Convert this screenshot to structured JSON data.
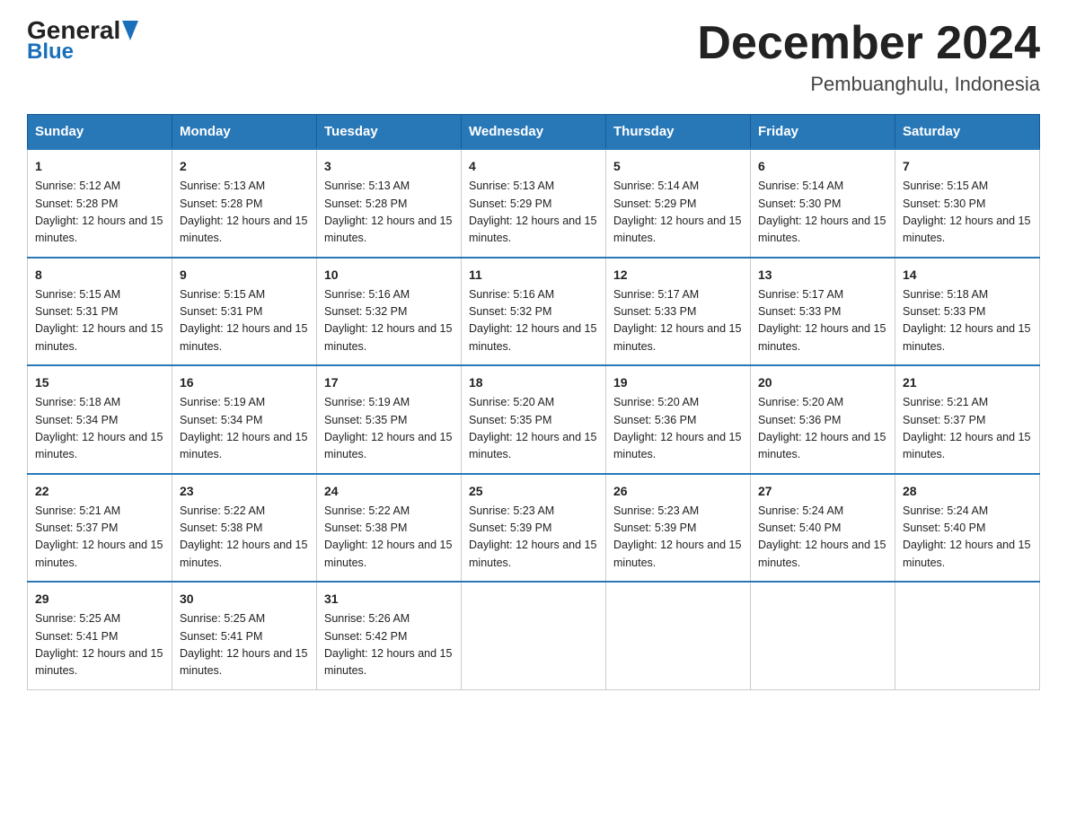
{
  "header": {
    "logo_general": "General",
    "logo_blue": "Blue",
    "title": "December 2024",
    "subtitle": "Pembuanghulu, Indonesia"
  },
  "columns": [
    "Sunday",
    "Monday",
    "Tuesday",
    "Wednesday",
    "Thursday",
    "Friday",
    "Saturday"
  ],
  "weeks": [
    [
      {
        "day": "1",
        "sunrise": "5:12 AM",
        "sunset": "5:28 PM",
        "daylight": "12 hours and 15 minutes."
      },
      {
        "day": "2",
        "sunrise": "5:13 AM",
        "sunset": "5:28 PM",
        "daylight": "12 hours and 15 minutes."
      },
      {
        "day": "3",
        "sunrise": "5:13 AM",
        "sunset": "5:28 PM",
        "daylight": "12 hours and 15 minutes."
      },
      {
        "day": "4",
        "sunrise": "5:13 AM",
        "sunset": "5:29 PM",
        "daylight": "12 hours and 15 minutes."
      },
      {
        "day": "5",
        "sunrise": "5:14 AM",
        "sunset": "5:29 PM",
        "daylight": "12 hours and 15 minutes."
      },
      {
        "day": "6",
        "sunrise": "5:14 AM",
        "sunset": "5:30 PM",
        "daylight": "12 hours and 15 minutes."
      },
      {
        "day": "7",
        "sunrise": "5:15 AM",
        "sunset": "5:30 PM",
        "daylight": "12 hours and 15 minutes."
      }
    ],
    [
      {
        "day": "8",
        "sunrise": "5:15 AM",
        "sunset": "5:31 PM",
        "daylight": "12 hours and 15 minutes."
      },
      {
        "day": "9",
        "sunrise": "5:15 AM",
        "sunset": "5:31 PM",
        "daylight": "12 hours and 15 minutes."
      },
      {
        "day": "10",
        "sunrise": "5:16 AM",
        "sunset": "5:32 PM",
        "daylight": "12 hours and 15 minutes."
      },
      {
        "day": "11",
        "sunrise": "5:16 AM",
        "sunset": "5:32 PM",
        "daylight": "12 hours and 15 minutes."
      },
      {
        "day": "12",
        "sunrise": "5:17 AM",
        "sunset": "5:33 PM",
        "daylight": "12 hours and 15 minutes."
      },
      {
        "day": "13",
        "sunrise": "5:17 AM",
        "sunset": "5:33 PM",
        "daylight": "12 hours and 15 minutes."
      },
      {
        "day": "14",
        "sunrise": "5:18 AM",
        "sunset": "5:33 PM",
        "daylight": "12 hours and 15 minutes."
      }
    ],
    [
      {
        "day": "15",
        "sunrise": "5:18 AM",
        "sunset": "5:34 PM",
        "daylight": "12 hours and 15 minutes."
      },
      {
        "day": "16",
        "sunrise": "5:19 AM",
        "sunset": "5:34 PM",
        "daylight": "12 hours and 15 minutes."
      },
      {
        "day": "17",
        "sunrise": "5:19 AM",
        "sunset": "5:35 PM",
        "daylight": "12 hours and 15 minutes."
      },
      {
        "day": "18",
        "sunrise": "5:20 AM",
        "sunset": "5:35 PM",
        "daylight": "12 hours and 15 minutes."
      },
      {
        "day": "19",
        "sunrise": "5:20 AM",
        "sunset": "5:36 PM",
        "daylight": "12 hours and 15 minutes."
      },
      {
        "day": "20",
        "sunrise": "5:20 AM",
        "sunset": "5:36 PM",
        "daylight": "12 hours and 15 minutes."
      },
      {
        "day": "21",
        "sunrise": "5:21 AM",
        "sunset": "5:37 PM",
        "daylight": "12 hours and 15 minutes."
      }
    ],
    [
      {
        "day": "22",
        "sunrise": "5:21 AM",
        "sunset": "5:37 PM",
        "daylight": "12 hours and 15 minutes."
      },
      {
        "day": "23",
        "sunrise": "5:22 AM",
        "sunset": "5:38 PM",
        "daylight": "12 hours and 15 minutes."
      },
      {
        "day": "24",
        "sunrise": "5:22 AM",
        "sunset": "5:38 PM",
        "daylight": "12 hours and 15 minutes."
      },
      {
        "day": "25",
        "sunrise": "5:23 AM",
        "sunset": "5:39 PM",
        "daylight": "12 hours and 15 minutes."
      },
      {
        "day": "26",
        "sunrise": "5:23 AM",
        "sunset": "5:39 PM",
        "daylight": "12 hours and 15 minutes."
      },
      {
        "day": "27",
        "sunrise": "5:24 AM",
        "sunset": "5:40 PM",
        "daylight": "12 hours and 15 minutes."
      },
      {
        "day": "28",
        "sunrise": "5:24 AM",
        "sunset": "5:40 PM",
        "daylight": "12 hours and 15 minutes."
      }
    ],
    [
      {
        "day": "29",
        "sunrise": "5:25 AM",
        "sunset": "5:41 PM",
        "daylight": "12 hours and 15 minutes."
      },
      {
        "day": "30",
        "sunrise": "5:25 AM",
        "sunset": "5:41 PM",
        "daylight": "12 hours and 15 minutes."
      },
      {
        "day": "31",
        "sunrise": "5:26 AM",
        "sunset": "5:42 PM",
        "daylight": "12 hours and 15 minutes."
      },
      null,
      null,
      null,
      null
    ]
  ]
}
